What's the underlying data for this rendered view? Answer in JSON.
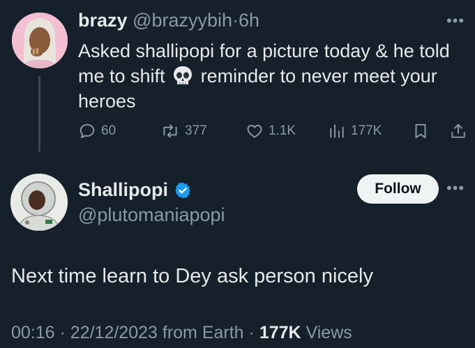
{
  "parent_tweet": {
    "display_name": "brazy",
    "handle": "@brazyybih",
    "separator": "·",
    "time_ago": "6h",
    "text_part1": "Asked shallipopi for a picture today & he told me to shift",
    "emoji": "skull-emoji",
    "text_part2": "reminder to never meet your heroes",
    "more_icon": "more-horizontal-icon",
    "actions": {
      "reply_count": "60",
      "retweet_count": "377",
      "like_count": "1.1K",
      "views_count": "177K"
    }
  },
  "focused_tweet": {
    "display_name": "Shallipopi",
    "verified": true,
    "handle": "@plutomaniapopi",
    "follow_label": "Follow",
    "text": "Next time learn to Dey ask person nicely",
    "meta": {
      "time": "00:16",
      "dot": "·",
      "date": "22/12/2023",
      "source": "from Earth",
      "views_count": "177K",
      "views_label": "Views"
    }
  },
  "colors": {
    "background": "#15202b",
    "text": "#e7e9ea",
    "muted": "#8b98a5",
    "verified": "#1d9bf0",
    "follow_bg": "#eff3f4"
  }
}
